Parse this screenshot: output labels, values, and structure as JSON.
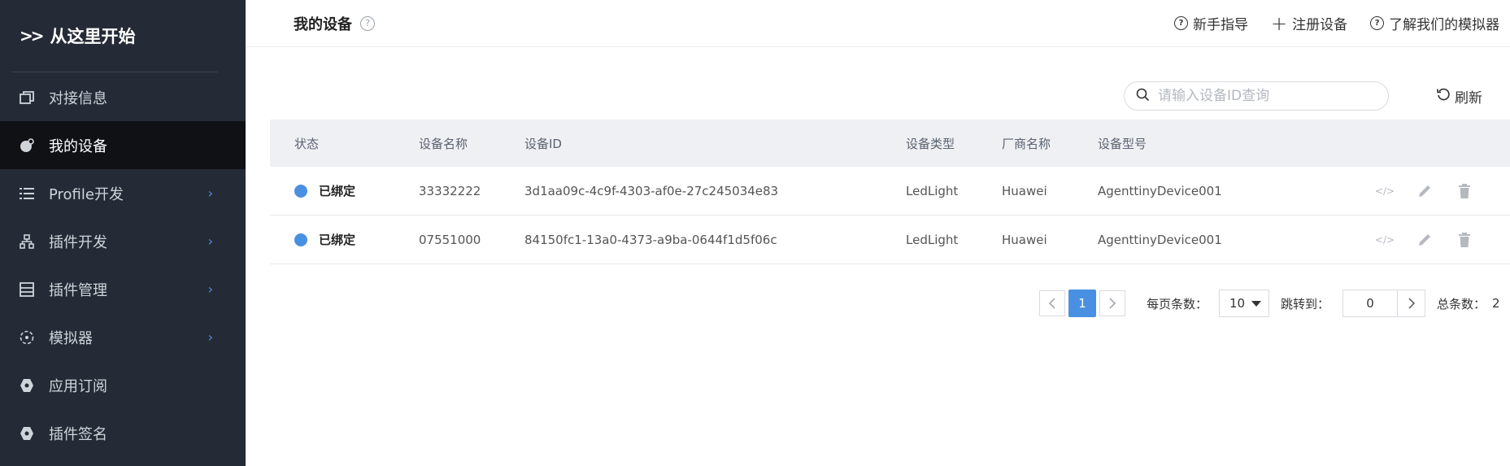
{
  "sidebar": {
    "brand": "从这里开始",
    "brand_chevron": ">>",
    "items": [
      {
        "label": "对接信息",
        "icon": "windows-icon",
        "arrow": false,
        "active": false
      },
      {
        "label": "我的设备",
        "icon": "device-icon",
        "arrow": false,
        "active": true
      },
      {
        "label": "Profile开发",
        "icon": "list-icon",
        "arrow": true,
        "active": false
      },
      {
        "label": "插件开发",
        "icon": "network-icon",
        "arrow": true,
        "active": false
      },
      {
        "label": "插件管理",
        "icon": "panel-icon",
        "arrow": true,
        "active": false
      },
      {
        "label": "模拟器",
        "icon": "simulator-icon",
        "arrow": true,
        "active": false
      },
      {
        "label": "应用订阅",
        "icon": "tag-icon",
        "arrow": false,
        "active": false
      },
      {
        "label": "插件签名",
        "icon": "tag-icon",
        "arrow": false,
        "active": false
      }
    ]
  },
  "header": {
    "title": "我的设备",
    "actions": {
      "guide": "新手指导",
      "register": "注册设备",
      "learn": "了解我们的模拟器"
    }
  },
  "toolbar": {
    "search_placeholder": "请输入设备ID查询",
    "refresh": "刷新"
  },
  "table": {
    "columns": [
      "状态",
      "设备名称",
      "设备ID",
      "设备类型",
      "厂商名称",
      "设备型号"
    ],
    "rows": [
      {
        "status": "已绑定",
        "name": "33332222",
        "id": "3d1aa09c-4c9f-4303-af0e-27c245034e83",
        "type": "LedLight",
        "vendor": "Huawei",
        "model": "AgenttinyDevice001"
      },
      {
        "status": "已绑定",
        "name": "07551000",
        "id": "84150fc1-13a0-4373-a9ba-0644f1d5f06c",
        "type": "LedLight",
        "vendor": "Huawei",
        "model": "AgenttinyDevice001"
      }
    ]
  },
  "pagination": {
    "current_page": "1",
    "page_size_label": "每页条数：",
    "page_size": "10",
    "jump_label": "跳转到：",
    "jump_value": "0",
    "total_label": "总条数：",
    "total_value": "2"
  },
  "colors": {
    "sidebar_bg": "#252b36",
    "accent": "#4a90e2",
    "active_bg": "#0f1115"
  }
}
